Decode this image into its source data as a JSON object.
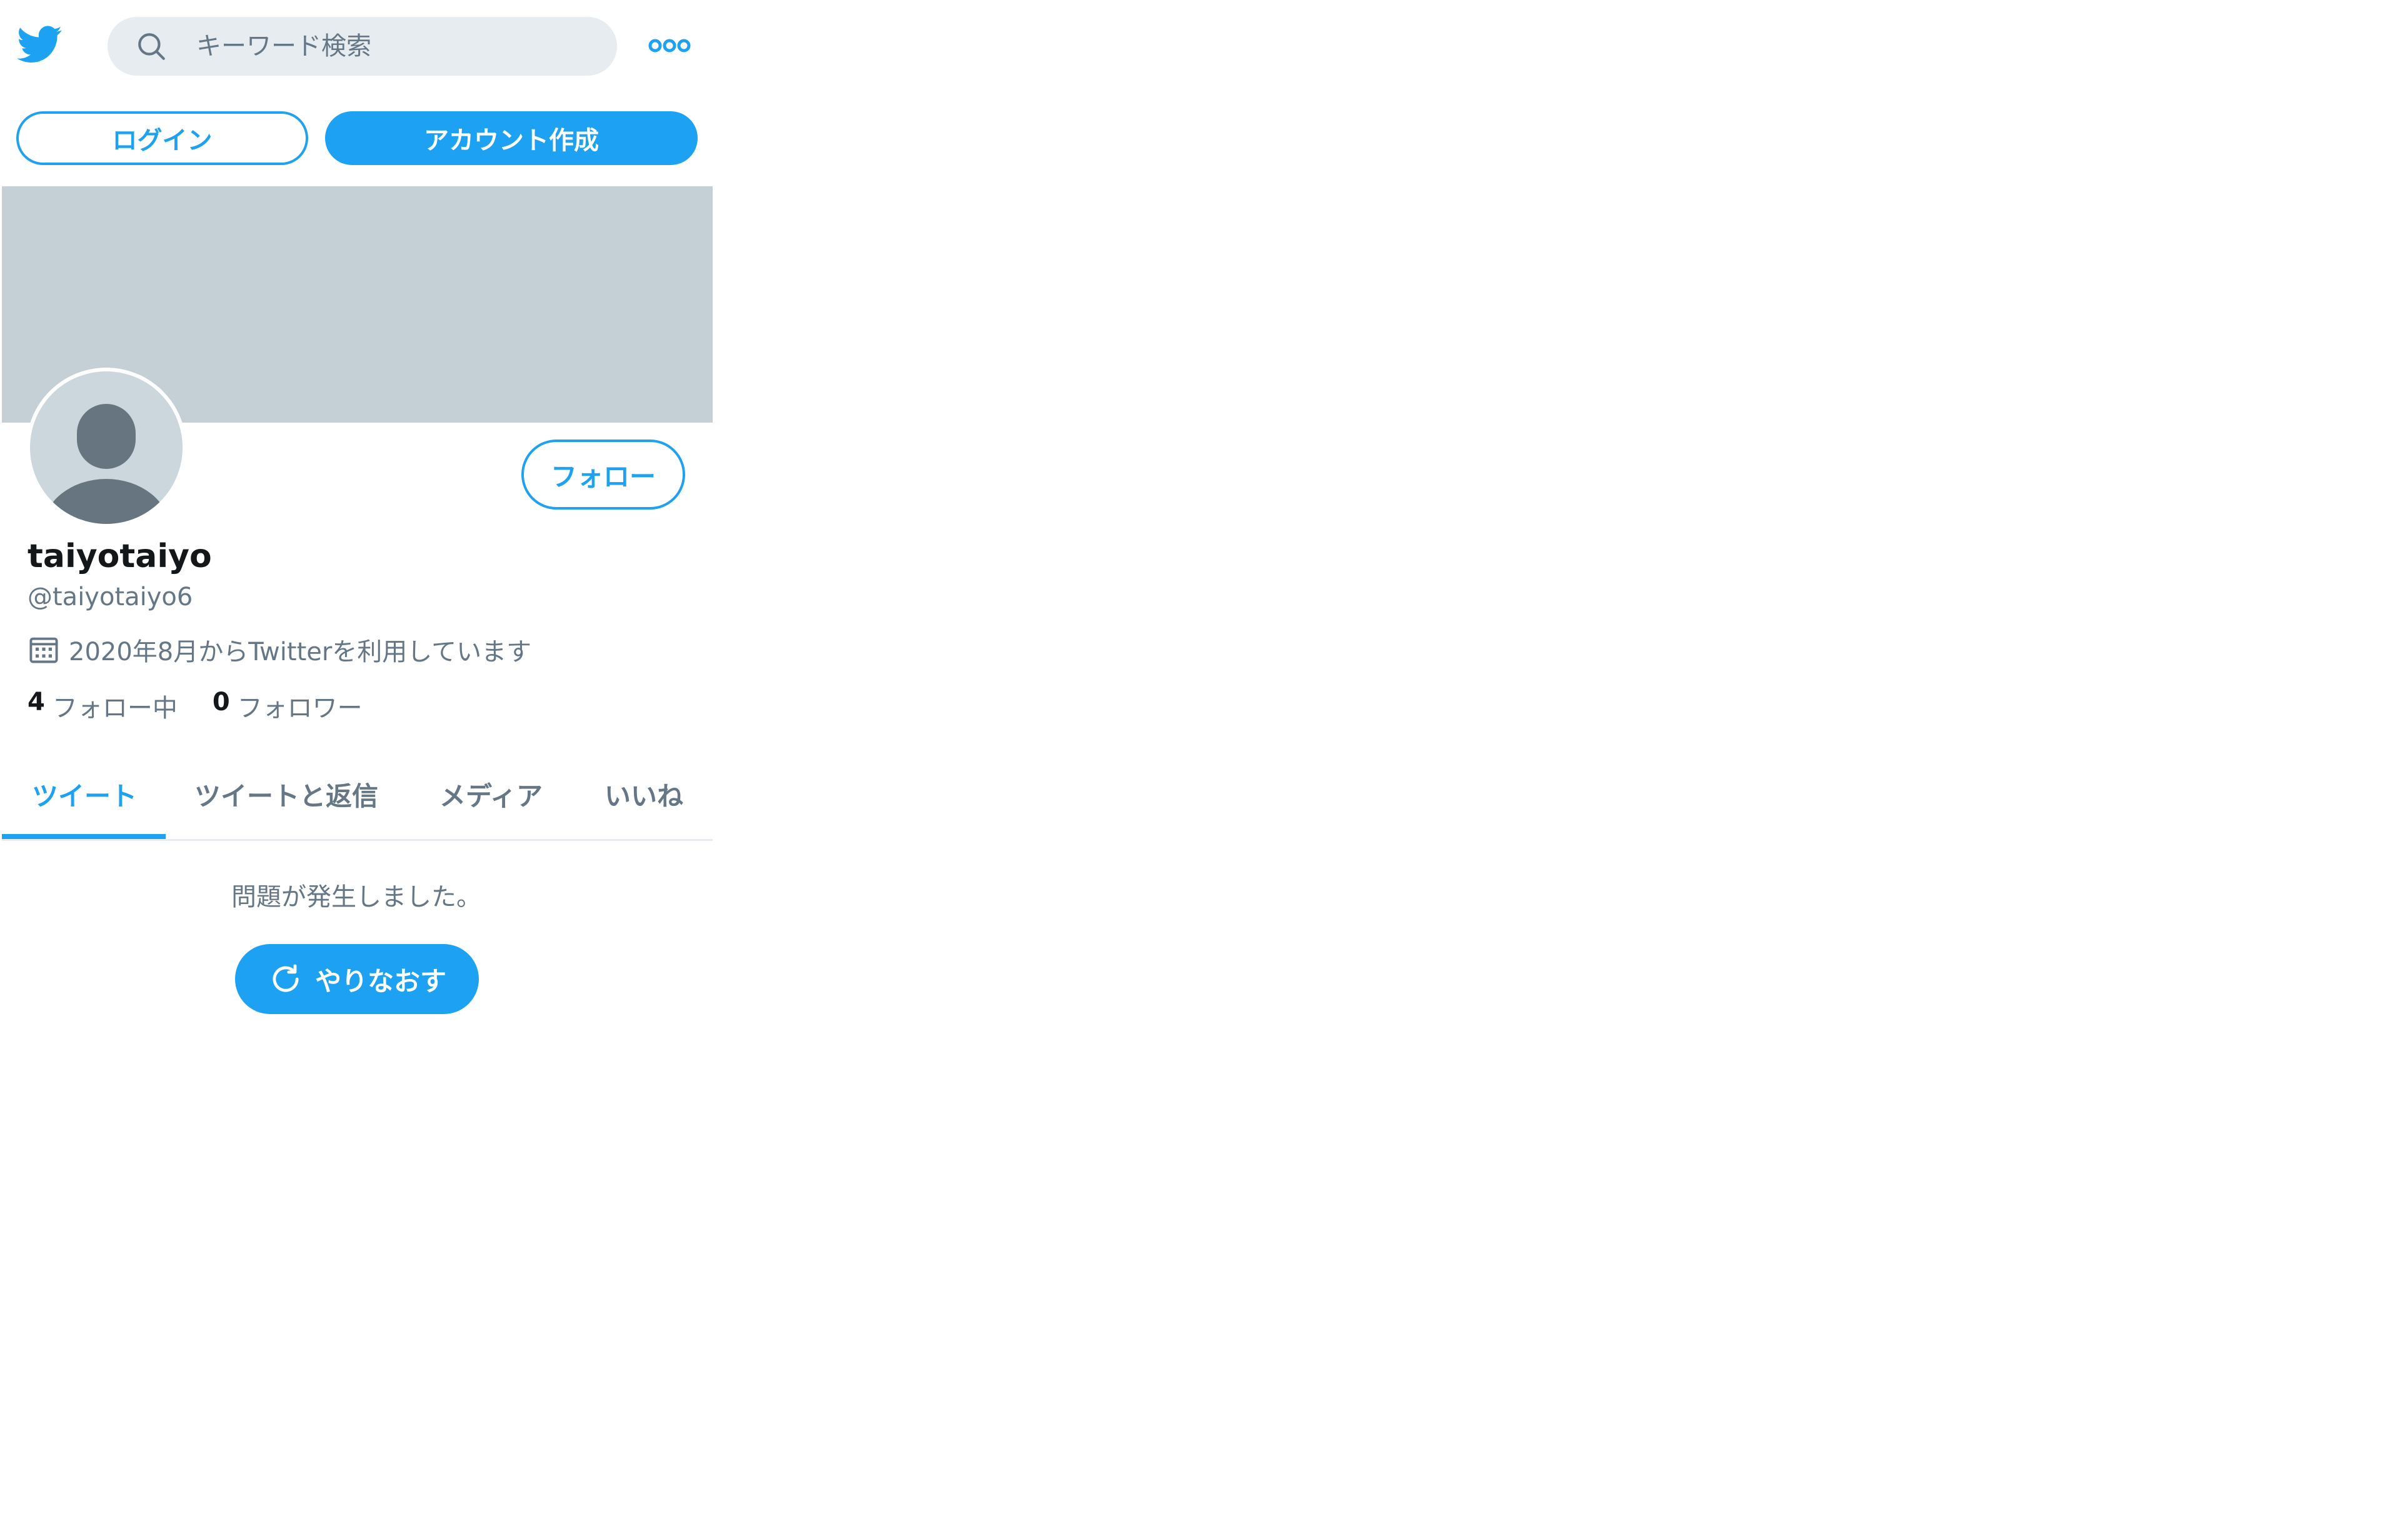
{
  "header": {
    "logo_icon": "twitter-bird-icon",
    "search": {
      "placeholder": "キーワード検索",
      "icon": "search-icon"
    },
    "more_icon": "more-dots-icon"
  },
  "auth": {
    "login_label": "ログイン",
    "signup_label": "アカウント作成"
  },
  "profile": {
    "display_name": "taiyotaiyo",
    "handle": "@taiyotaiyo6",
    "joined": "2020年8月からTwitterを利用しています",
    "follow_label": "フォロー",
    "following_count": "4",
    "following_label": "フォロー中",
    "followers_count": "0",
    "followers_label": "フォロワー"
  },
  "tabs": [
    {
      "label": "ツイート",
      "active": true
    },
    {
      "label": "ツイートと返信",
      "active": false
    },
    {
      "label": "メディア",
      "active": false
    },
    {
      "label": "いいね",
      "active": false
    }
  ],
  "timeline": {
    "error_message": "問題が発生しました。",
    "retry_label": "やりなおす"
  },
  "colors": {
    "accent": "#1da1f2",
    "banner": "#c4cfd6",
    "secondary_text": "#657786",
    "search_bg": "#e6ecf0"
  }
}
